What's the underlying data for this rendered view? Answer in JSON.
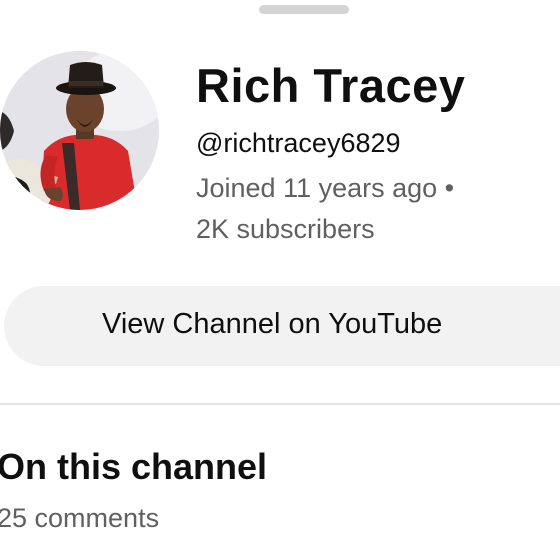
{
  "sheet": {
    "channel": {
      "name": "Rich Tracey",
      "handle": "@richtracey6829",
      "joined": "Joined 11 years ago •",
      "subscribers": "2K subscribers"
    },
    "view_channel_button_label": "View Channel on YouTube",
    "section": {
      "title": "On this channel",
      "comments": "25 comments"
    }
  },
  "colors": {
    "primary_text": "#0f0f0f",
    "secondary_text": "#606060",
    "button_background": "#f2f2f2",
    "divider": "#e5e5e5",
    "drag_handle": "#d4d4d4",
    "avatar_shirt": "#d92b2b"
  },
  "icons": [
    "drag-handle",
    "channel-avatar"
  ]
}
